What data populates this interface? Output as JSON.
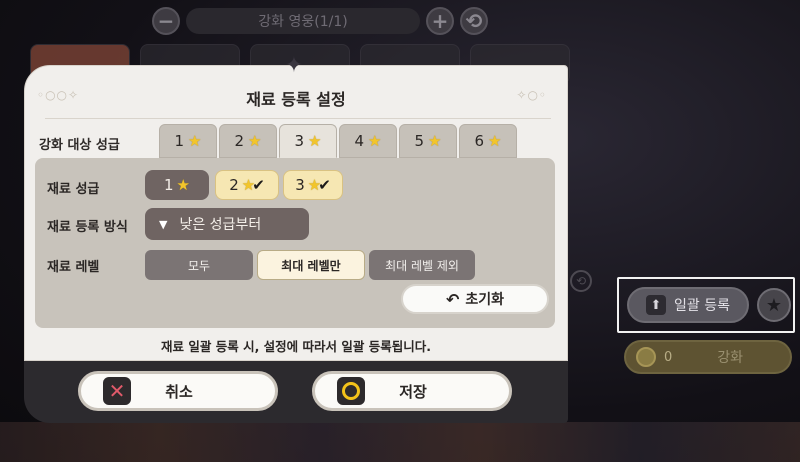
{
  "top_bar": {
    "minus": "−",
    "title": "강화 영웅(1/1)",
    "plus": "+",
    "refresh": "⟲"
  },
  "modal": {
    "title": "재료 등록 설정",
    "ornament_left": "◦○○✧",
    "ornament_right": "✧○◦",
    "target_grade_label": "강화 대상 성급",
    "target_grades": [
      "1",
      "2",
      "3",
      "4",
      "5",
      "6"
    ],
    "target_grade_selected": "3",
    "material_grade_label": "재료 성급",
    "material_grades": [
      {
        "value": "1",
        "selected": false
      },
      {
        "value": "2",
        "selected": true
      },
      {
        "value": "3",
        "selected": true
      }
    ],
    "method_label": "재료 등록 방식",
    "method_value": "낮은 성급부터",
    "level_label": "재료 레벨",
    "level_options": [
      "모두",
      "최대 레벨만",
      "최대 레벨 제외"
    ],
    "level_selected": "최대 레벨만",
    "reset_label": "초기화",
    "notice": "재료 일괄 등록 시, 설정에 따라서 일괄 등록됩니다.",
    "cancel_label": "취소",
    "save_label": "저장"
  },
  "side": {
    "bulk_register_label": "일괄 등록",
    "enhance_cost": "0",
    "enhance_label": "강화"
  },
  "colors": {
    "accent_gold": "#f2c52c",
    "selected_chip": "#f6e7b3",
    "modal_bg": "#f1efec",
    "cancel_icon": "#e05a6a",
    "save_icon": "#f3c21a"
  }
}
